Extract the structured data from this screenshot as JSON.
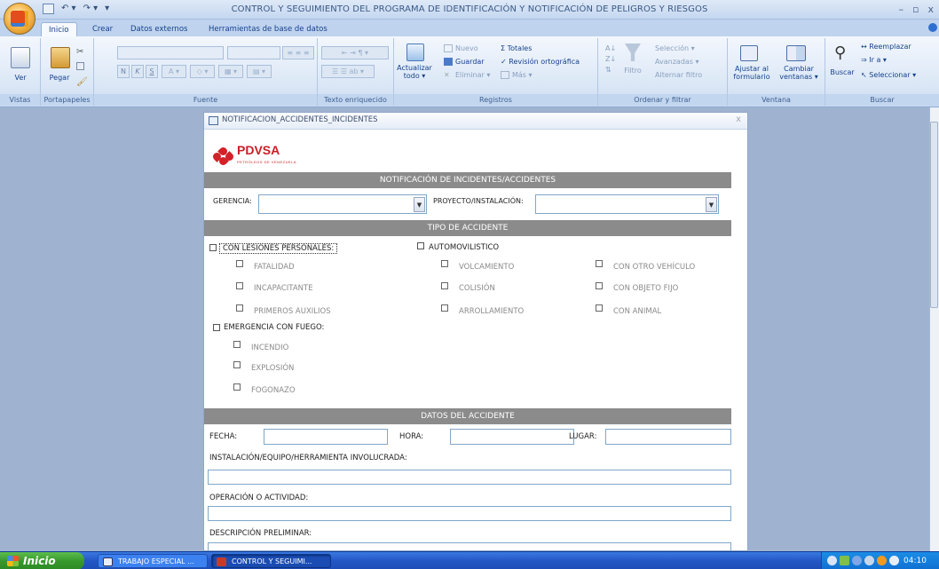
{
  "window": {
    "title": "CONTROL Y SEGUIMIENTO DEL PROGRAMA DE IDENTIFICACIÓN Y NOTIFICACIÓN DE PELIGROS Y RIESGOS",
    "minimize": "–",
    "restore": "▫",
    "close": "x"
  },
  "tabs": [
    "Inicio",
    "Crear",
    "Datos externos",
    "Herramientas de base de datos"
  ],
  "ribbon": {
    "vistas": {
      "label": "Vistas",
      "ver": "Ver"
    },
    "portapapeles": {
      "label": "Portapapeles",
      "pegar": "Pegar"
    },
    "fuente": {
      "label": "Fuente",
      "bold": "N",
      "italic": "K",
      "underline": "S"
    },
    "texto_enriquecido": {
      "label": "Texto enriquecido"
    },
    "registros": {
      "label": "Registros",
      "actualizar": "Actualizar",
      "todo": "todo ▾",
      "nuevo": "Nuevo",
      "guardar": "Guardar",
      "eliminar": "Eliminar ▾",
      "totales": "Totales",
      "revision": "Revisión ortográfica",
      "mas": "Más ▾"
    },
    "ordenar": {
      "label": "Ordenar y filtrar",
      "filtro": "Filtro",
      "seleccion": "Selección ▾",
      "avanzadas": "Avanzadas ▾",
      "alternar": "Alternar filtro"
    },
    "ventana": {
      "label": "Ventana",
      "ajustar": "Ajustar al formulario",
      "cambiar": "Cambiar ventanas ▾"
    },
    "buscar": {
      "label": "Buscar",
      "buscar": "Buscar",
      "reemplazar": "Reemplazar",
      "ir_a": "Ir a ▾",
      "seleccionar": "Seleccionar ▾"
    }
  },
  "form": {
    "title": "NOTIFICACION_ACCIDENTES_INCIDENTES",
    "close": "x",
    "logo_text": "PDVSA",
    "logo_sub": "PETRÓLEOS DE VENEZUELA",
    "section_notif": "NOTIFICACIÓN DE INCIDENTES/ACCIDENTES",
    "gerencia_label": "GERENCIA:",
    "proyecto_label": "PROYECTO/INSTALACIÓN:",
    "section_tipo": "TIPO DE ACCIDENTE",
    "con_lesiones": "CON LESIONES PERSONALES:",
    "automovilistico": "AUTOMOVILISTICO",
    "fatalidad": "FATALIDAD",
    "incapacitante": "INCAPACITANTE",
    "primeros_auxilios": "PRIMEROS AUXILIOS",
    "volcamiento": "VOLCAMIENTO",
    "colision": "COLISIÓN",
    "arrollamiento": "ARROLLAMIENTO",
    "con_otro_vehiculo": "CON OTRO VEHÍCULO",
    "con_objeto_fijo": "CON OBJETO FIJO",
    "con_animal": "CON ANIMAL",
    "emergencia_fuego": "EMERGENCIA CON FUEGO:",
    "incendio": "INCENDIO",
    "explosion": "EXPLOSIÓN",
    "fogonazo": "FOGONAZO",
    "section_datos": "DATOS DEL ACCIDENTE",
    "fecha_label": "FECHA:",
    "hora_label": "HORA:",
    "lugar_label": "LUGAR:",
    "instalacion_label": "INSTALACIÓN/EQUIPO/HERRAMIENTA INVOLUCRADA:",
    "operacion_label": "OPERACIÓN O ACTIVIDAD:",
    "descripcion_label": "DESCRIPCIÓN PRELIMINAR:"
  },
  "taskbar": {
    "start": "Inicio",
    "task1": "TRABAJO ESPECIAL ...",
    "task2": "CONTROL Y SEGUIMI...",
    "clock": "04:10 p.m."
  },
  "colors": {
    "pdvsa_red": "#c81e27",
    "band_gray": "#8b8b8b",
    "ribbon_blue": "#dbe7f6"
  }
}
